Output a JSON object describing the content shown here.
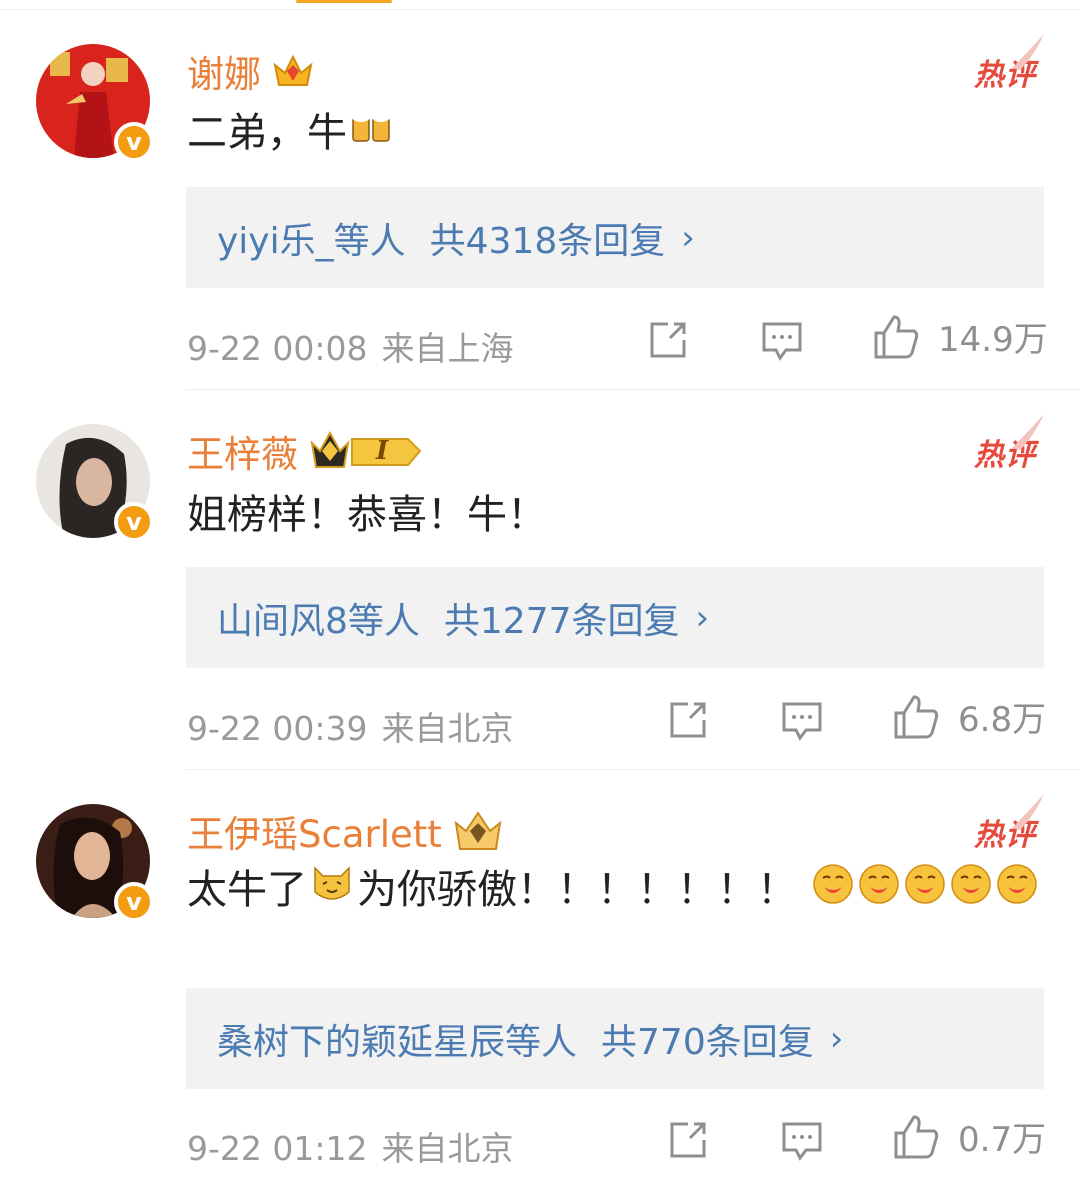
{
  "hot_label": "热评",
  "comments": [
    {
      "author": "谢娜",
      "text": "二弟，牛",
      "replies_who": "yiyi乐_等人",
      "replies_total": "共4318条回复",
      "time": "9-22 00:08",
      "location": "来自上海",
      "likes": "14.9万"
    },
    {
      "author": "王梓薇",
      "text": "姐榜样！恭喜！牛！",
      "replies_who": "山间风8等人",
      "replies_total": "共1277条回复",
      "time": "9-22 00:39",
      "location": "来自北京",
      "likes": "6.8万"
    },
    {
      "author": "王伊瑶Scarlett",
      "text_before": "太牛了",
      "text_after": "为你骄傲！！！！！！！",
      "replies_who": "桑树下的颖延星辰等人",
      "replies_total": "共770条回复",
      "time": "9-22 01:12",
      "location": "来自北京",
      "likes": "0.7万"
    }
  ],
  "badge_letter": "I",
  "colors": {
    "name": "#e8803a",
    "link": "#4b7bb0",
    "hot": "#e64a3c",
    "meta": "#9a9a9a"
  }
}
